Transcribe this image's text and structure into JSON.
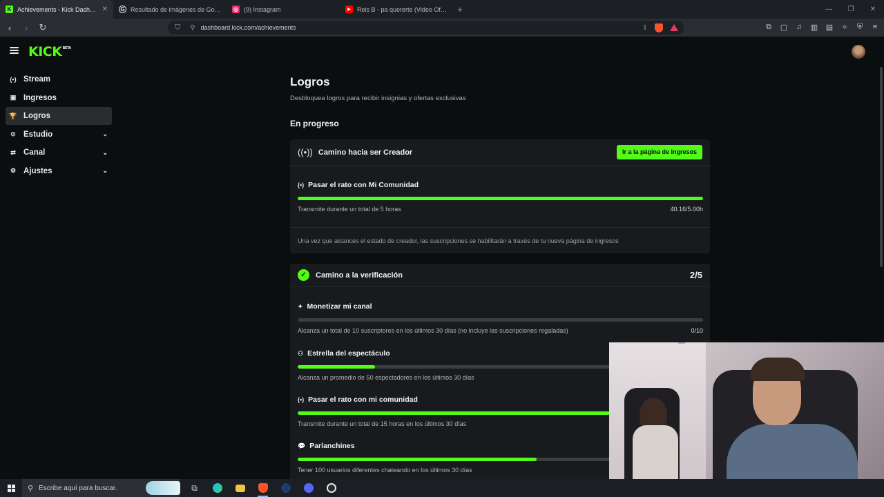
{
  "browser": {
    "tabs": [
      {
        "title": "Achievements - Kick Dashboard",
        "favicon_color": "#53fc18",
        "favicon_glyph": "K",
        "active": true
      },
      {
        "title": "Resultado de imágenes de Google",
        "favicon_color": "#e8eaeb",
        "favicon_glyph": "G",
        "active": false
      },
      {
        "title": "(9) Instagram",
        "favicon_color": "#e1306c",
        "favicon_glyph": "◎",
        "active": false
      },
      {
        "title": "Reis B - pa quererte (Video Oficial) -",
        "favicon_color": "#ff0000",
        "favicon_glyph": "▶",
        "active": false
      }
    ],
    "url": "dashboard.kick.com/achievements"
  },
  "header": {
    "logo": "KICK",
    "logo_badge": "BETA"
  },
  "sidebar": {
    "items": [
      {
        "label": "Stream",
        "icon": "broadcast-icon",
        "glyph": "(•)",
        "active": false,
        "expandable": false
      },
      {
        "label": "Ingresos",
        "icon": "revenue-icon",
        "glyph": "▣",
        "active": false,
        "expandable": false
      },
      {
        "label": "Logros",
        "icon": "trophy-icon",
        "glyph": "🏆",
        "active": true,
        "expandable": false
      },
      {
        "label": "Estudio",
        "icon": "studio-icon",
        "glyph": "⊙",
        "active": false,
        "expandable": true
      },
      {
        "label": "Canal",
        "icon": "channel-icon",
        "glyph": "⇄",
        "active": false,
        "expandable": true
      },
      {
        "label": "Ajustes",
        "icon": "gear-icon",
        "glyph": "⚙",
        "active": false,
        "expandable": true
      }
    ]
  },
  "main": {
    "title": "Logros",
    "subtitle": "Desbloquea logros para recibir insignias y ofertas exclusivas",
    "section": "En progreso",
    "creator_card": {
      "title": "Camino hacia ser Creador",
      "button": "Ir a la página de ingresos",
      "task": {
        "title": "Pasar el rato con Mi Comunidad",
        "description": "Transmite durante un total de 5 horas",
        "progress_text": "40.16/5.00h",
        "progress": 1.0
      },
      "note": "Una vez que alcances el estado de creador, las suscripciones se habilitarán a través de tu nueva página de ingresos"
    },
    "verification_card": {
      "title": "Camino a la verificación",
      "count": "2/5",
      "tasks": [
        {
          "title": "Monetizar mi canal",
          "icon": "sparkle-icon",
          "glyph": "✦",
          "description": "Alcanza un total de 10 suscriptores en los últimos 30 días (no incluye las suscripciones regaladas)",
          "progress_text": "0/10",
          "progress": 0.0
        },
        {
          "title": "Estrella del espectáculo",
          "icon": "viewers-icon",
          "glyph": "⚇",
          "description": "Alcanza un promedio de 50 espectadores en los últimos 30 días",
          "progress_text": "",
          "progress": 0.19
        },
        {
          "title": "Pasar el rato con mi comunidad",
          "icon": "broadcast-icon",
          "glyph": "(•)",
          "description": "Transmite durante un total de 15 horas en los últimos 30 días",
          "progress_text": "",
          "progress": 0.77
        },
        {
          "title": "Parlanchines",
          "icon": "chat-icon",
          "glyph": "💬",
          "description": "Tener 100 usuarios diferentes chateando en los últimos 30 días",
          "progress_text": "",
          "progress": 0.59
        }
      ]
    }
  },
  "taskbar": {
    "search_placeholder": "Escribe aquí para buscar."
  }
}
